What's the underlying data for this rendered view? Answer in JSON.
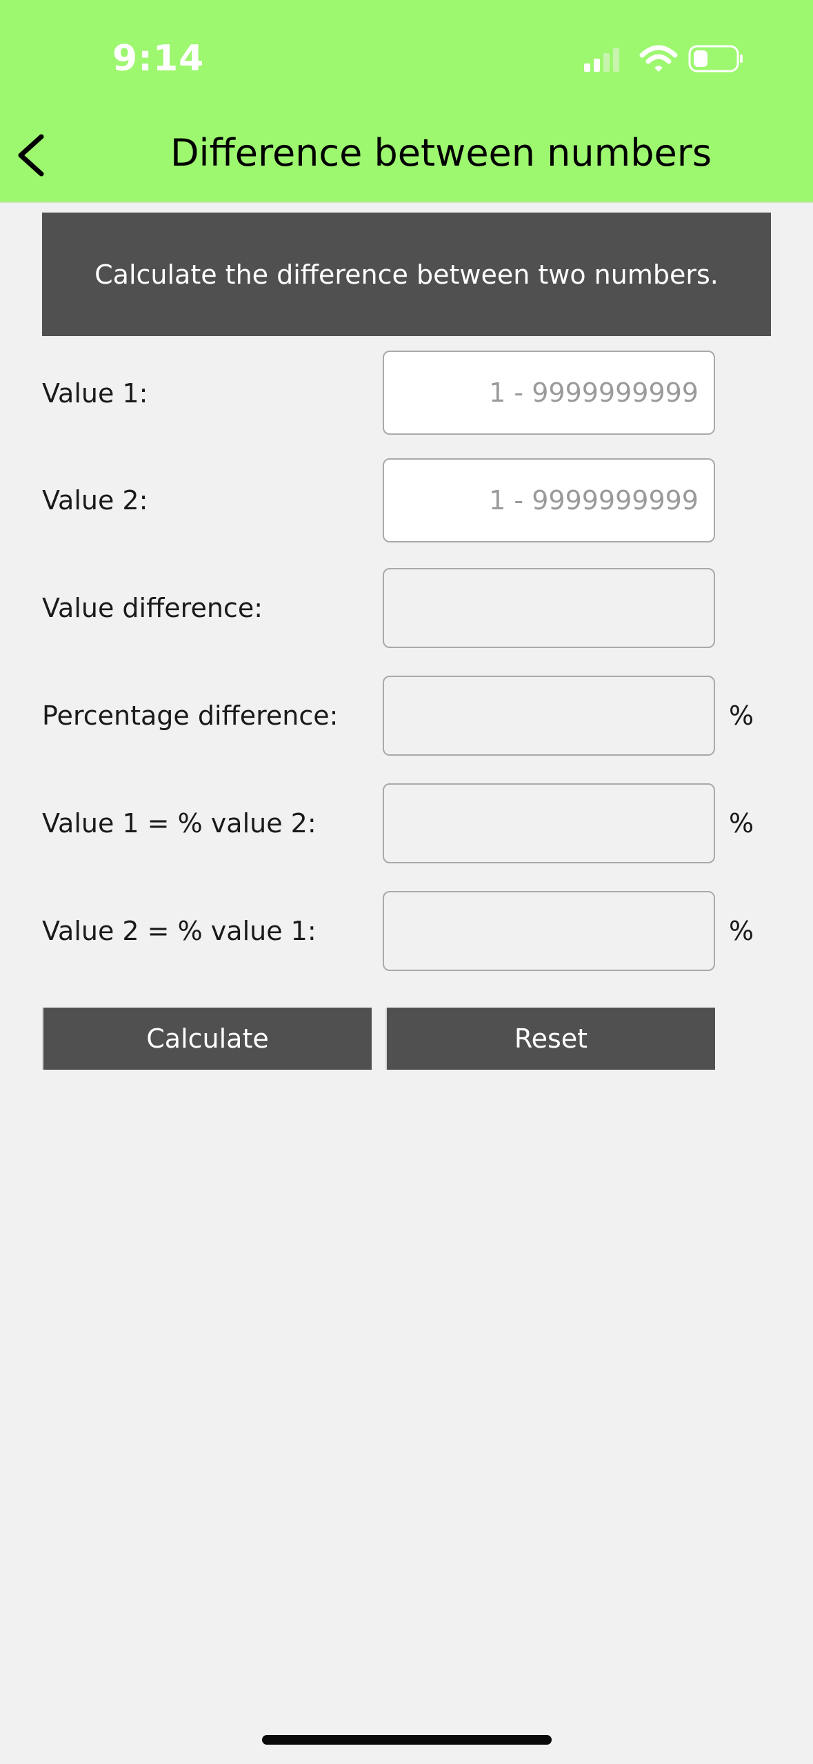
{
  "status_bar": {
    "time": "9:14",
    "signal_icon": "cellular-signal-icon",
    "wifi_icon": "wifi-icon",
    "battery_icon": "battery-icon"
  },
  "nav": {
    "back_icon": "chevron-left-icon",
    "title": "Difference between numbers"
  },
  "banner": {
    "text": "Calculate the difference between two numbers."
  },
  "inputs": [
    {
      "label": "Value 1:",
      "placeholder": "1 - 9999999999",
      "value": ""
    },
    {
      "label": "Value 2:",
      "placeholder": "1 - 9999999999",
      "value": ""
    }
  ],
  "outputs": [
    {
      "label": "Value difference:",
      "value": "",
      "unit": ""
    },
    {
      "label": "Percentage difference:",
      "value": "",
      "unit": "%"
    },
    {
      "label": "Value 1 = % value 2:",
      "value": "",
      "unit": "%"
    },
    {
      "label": "Value 2 = % value 1:",
      "value": "",
      "unit": "%"
    }
  ],
  "buttons": {
    "calculate": "Calculate",
    "reset": "Reset"
  },
  "colors": {
    "header_bg": "#9df76f",
    "banner_bg": "#505050",
    "button_bg": "#505050",
    "page_bg": "#f1f1f1"
  }
}
